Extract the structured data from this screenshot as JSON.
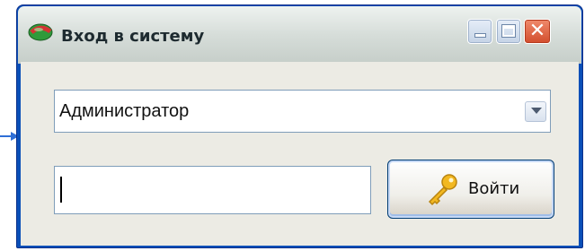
{
  "window": {
    "title": "Вход в систему",
    "icon": "app-logo-icon",
    "controls": {
      "minimize_icon": "minimize-icon",
      "maximize_icon": "maximize-icon",
      "close_label": "✕"
    }
  },
  "form": {
    "user_select": {
      "value": "Администратор",
      "icon": "chevron-down-icon"
    },
    "password": {
      "value": ""
    },
    "login_button": {
      "label": "Войти",
      "icon": "key-icon"
    }
  },
  "colors": {
    "frame": "#0a4fb8",
    "client_bg": "#ecebe4",
    "close_button": "#d24d2d",
    "key": "#f2b821"
  }
}
